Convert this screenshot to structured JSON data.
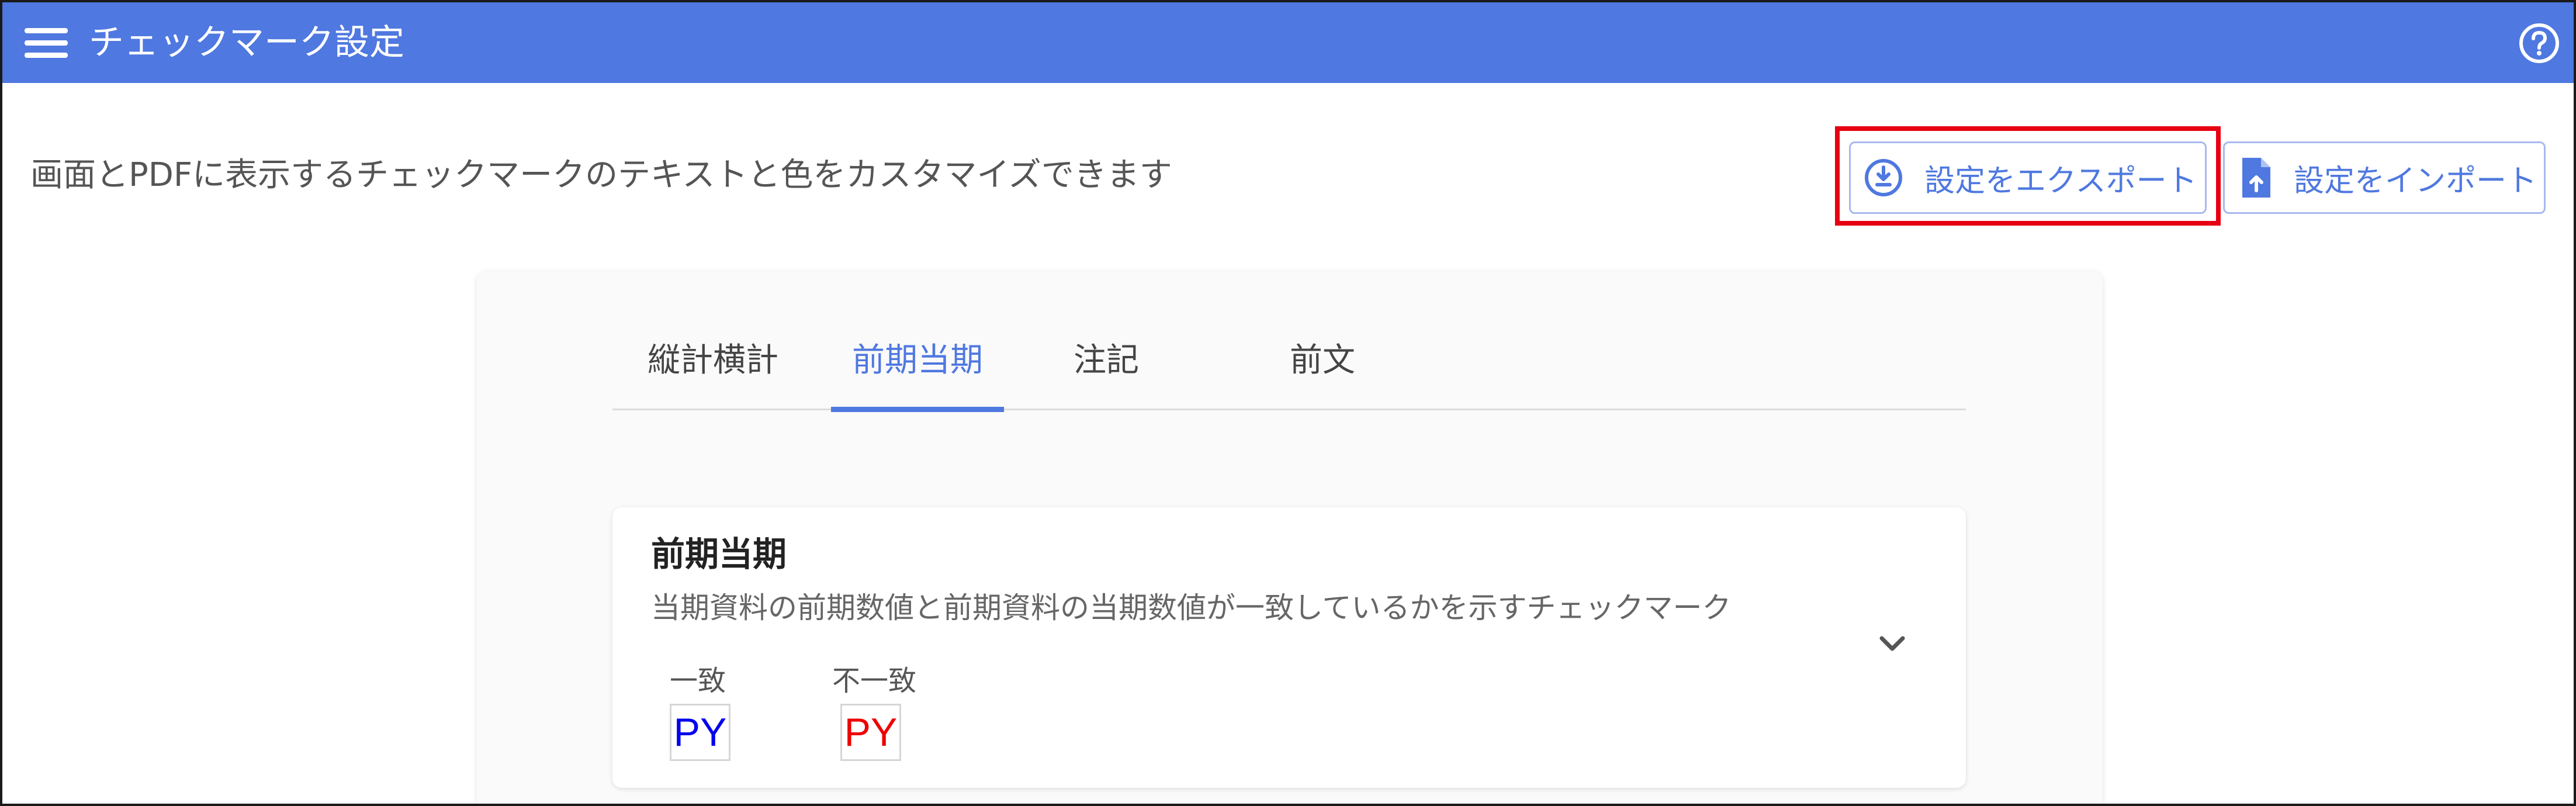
{
  "header": {
    "title": "チェックマーク設定",
    "menu_icon": "hamburger-menu-icon",
    "help_icon": "help-circle-icon"
  },
  "colors": {
    "primary": "#4f78e0",
    "highlight": "#e60012",
    "match": "#0000ee",
    "mismatch": "#ee0000"
  },
  "description": "画面とPDFに表示するチェックマークのテキストと色をカスタマイズできます",
  "actions": {
    "export_label": "設定をエクスポート",
    "export_icon": "download-circle-icon",
    "import_label": "設定をインポート",
    "import_icon": "file-upload-icon"
  },
  "tabs": [
    {
      "label": "縦計横計",
      "active": false
    },
    {
      "label": "前期当期",
      "active": true
    },
    {
      "label": "注記",
      "active": false
    },
    {
      "label": "前文",
      "active": false
    }
  ],
  "panel": {
    "title": "前期当期",
    "description": "当期資料の前期数値と前期資料の当期数値が一致しているかを示すチェックマーク",
    "expand_icon": "chevron-down-icon",
    "marks": [
      {
        "label": "一致",
        "text": "PY",
        "color": "#0000ee"
      },
      {
        "label": "不一致",
        "text": "PY",
        "color": "#ee0000"
      }
    ]
  }
}
